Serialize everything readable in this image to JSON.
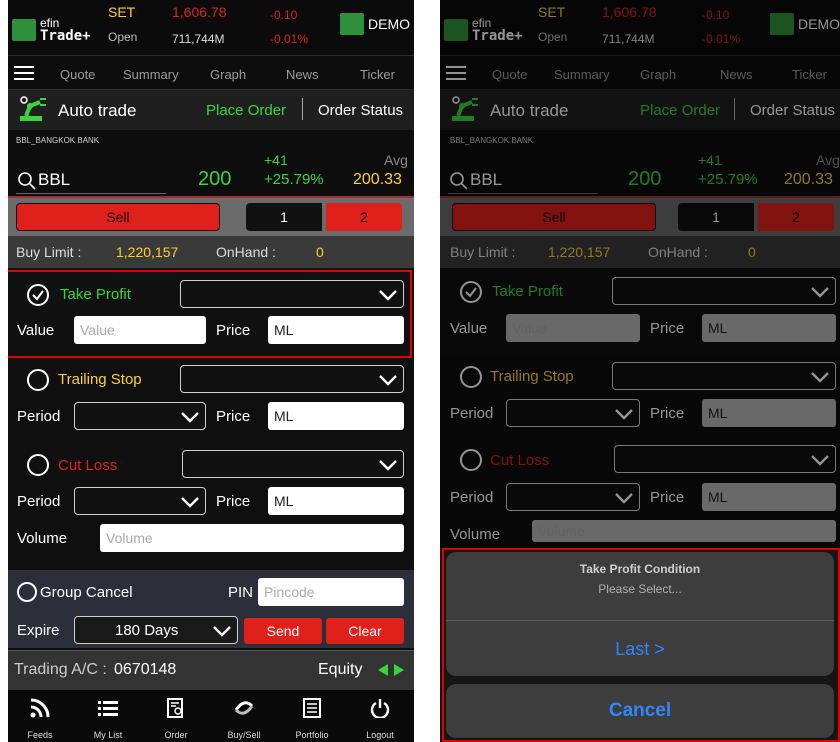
{
  "left": {
    "logo_top": "efin",
    "logo_bottom": "Trade+",
    "index_name": "SET",
    "index_status": "Open",
    "index_value": "1,606.78",
    "index_volume": "711,744M",
    "index_change": "-0.10",
    "index_pct": "-0.01%",
    "demo_label": "DEMO",
    "menu": [
      "Quote",
      "Summary",
      "Graph",
      "News",
      "Ticker"
    ],
    "auto_trade": "Auto trade",
    "place_order": "Place Order",
    "order_status": "Order Status",
    "company": "BBL_BANGKOK BANK",
    "symbol": "BBL",
    "last_price": "200",
    "change": "+41",
    "change_pct": "+25.79%",
    "avg_label": "Avg",
    "avg_value": "200.33",
    "sell_label": "Sell",
    "toggle_1": "1",
    "toggle_2": "2",
    "buy_limit_label": "Buy Limit :",
    "buy_limit_value": "1,220,157",
    "onhand_label": "OnHand :",
    "onhand_value": "0",
    "take_profit": "Take Profit",
    "value_label": "Value",
    "value_placeholder": "Value",
    "price_label": "Price",
    "price_value": "ML",
    "trailing_stop": "Trailing Stop",
    "period_label": "Period",
    "cut_loss": "Cut Loss",
    "volume_label": "Volume",
    "volume_placeholder": "Volume",
    "group_cancel": "Group Cancel",
    "pin_label": "PIN",
    "pin_placeholder": "Pincode",
    "expire_label": "Expire",
    "expire_value": "180 Days",
    "send": "Send",
    "clear": "Clear",
    "account_label": "Trading A/C :",
    "account_value": "0670148",
    "account_type": "Equity",
    "tabs": [
      "Feeds",
      "My List",
      "Order",
      "Buy/Sell",
      "Portfolio",
      "Logout"
    ]
  },
  "right": {
    "logo_top": "efin",
    "logo_bottom": "Trade+",
    "index_name": "SET",
    "index_status": "Open",
    "index_value": "1,606.78",
    "index_volume": "711,744M",
    "index_change": "-0.10",
    "index_pct": "-0.01%",
    "demo_label": "DEMO",
    "menu": [
      "Quote",
      "Summary",
      "Graph",
      "News",
      "Ticker"
    ],
    "auto_trade": "Auto trade",
    "place_order": "Place Order",
    "order_status": "Order Status",
    "company": "BBL_BANGKOK BANK",
    "symbol": "BBL",
    "last_price": "200",
    "change": "+41",
    "change_pct": "+25.79%",
    "avg_label": "Avg",
    "avg_value": "200.33",
    "sell_label": "Sell",
    "toggle_1": "1",
    "toggle_2": "2",
    "buy_limit_label": "Buy Limit :",
    "buy_limit_value": "1,220,157",
    "onhand_label": "OnHand :",
    "onhand_value": "0",
    "take_profit": "Take Profit",
    "value_label": "Value",
    "value_placeholder": "Value",
    "price_label": "Price",
    "price_value": "ML",
    "trailing_stop": "Trailing Stop",
    "period_label": "Period",
    "cut_loss": "Cut Loss",
    "volume_label": "Volume",
    "volume_placeholder": "Volume",
    "sheet_title": "Take Profit Condition",
    "sheet_subtitle": "Please Select...",
    "sheet_option": "Last >",
    "sheet_cancel": "Cancel"
  },
  "colors": {
    "accent_green": "#39d639",
    "sell_red": "#e0201b",
    "avg_yellow": "#ffd12a",
    "sheet_blue": "#2f86ff",
    "highlight_box": "#e00000"
  }
}
